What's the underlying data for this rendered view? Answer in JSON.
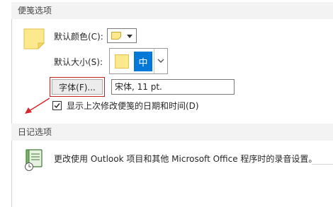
{
  "notes_section": {
    "title": "便笺选项",
    "default_color_label": "默认颜色(C):",
    "default_size_label": "默认大小(S):",
    "size_value": "中",
    "font_button_label": "字体(F)...",
    "font_value": "宋体, 11 pt.",
    "show_date_checkbox_label": "显示上次修改便笺的日期和时间(D)",
    "show_date_checked": true
  },
  "journal_section": {
    "title": "日记选项",
    "description": "更改使用 Outlook 项目和其他 Microsoft Office 程序时的录音设置。"
  },
  "colors": {
    "section_header_bg": "#f3f3f3",
    "sticky_note": "#fde98d",
    "selected_size_bg": "#0078d7",
    "annotation_red": "#d9262c",
    "font_button_highlight": "#c21f1f"
  },
  "icons": {
    "notes": "sticky-note-icon",
    "journal": "journal-recording-icon",
    "dropdown": "chevron-down-icon",
    "arrow": "red-arrow-annotation"
  }
}
